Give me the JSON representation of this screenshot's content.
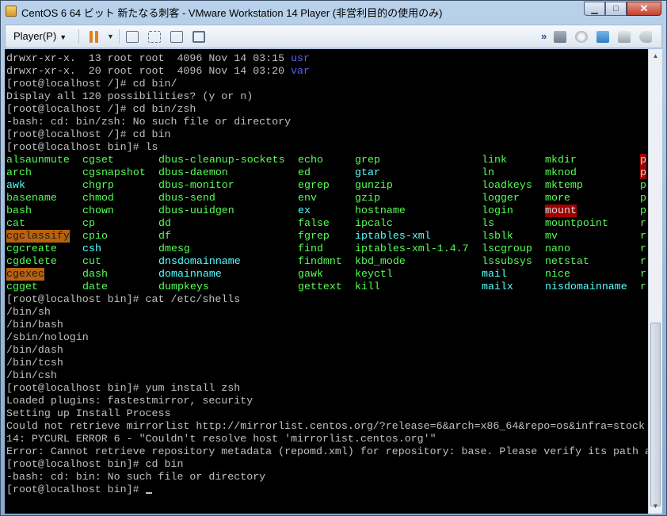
{
  "window": {
    "title": "CentOS 6 64 ビット 新たなる刺客 - VMware Workstation 14 Player (非営利目的の使用のみ)"
  },
  "toolbar": {
    "player_label": "Player(P)"
  },
  "colors": {
    "terminal_bg": "#000000",
    "text": "#c0c0c0",
    "exec_green": "#55ff55",
    "dir_blue": "#5c5cff",
    "link_cyan": "#55ffff",
    "setgid_orange": "#b8620f",
    "setuid_red": "#a00000"
  },
  "terminal": {
    "pre": [
      {
        "prefix": "drwxr-xr-x.  13 root root  4096 Nov 14 03:15 ",
        "dir": "usr"
      },
      {
        "prefix": "drwxr-xr-x.  20 root root  4096 Nov 14 03:20 ",
        "dir": "var"
      },
      {
        "text": "[root@localhost /]# cd bin/"
      },
      {
        "text": "Display all 120 possibilities? (y or n)"
      },
      {
        "text": "[root@localhost /]# cd bin/zsh"
      },
      {
        "text": "-bash: cd: bin/zsh: No such file or directory"
      },
      {
        "text": "[root@localhost /]# cd bin"
      },
      {
        "text": "[root@localhost bin]# ls"
      }
    ],
    "ls_rows": [
      [
        {
          "t": "alsaunmute",
          "c": "green"
        },
        {
          "t": "cgset",
          "c": "green"
        },
        {
          "t": "dbus-cleanup-sockets",
          "c": "green"
        },
        {
          "t": "echo",
          "c": "green"
        },
        {
          "t": "grep",
          "c": "green"
        },
        {
          "t": "link",
          "c": "green"
        },
        {
          "t": "mkdir",
          "c": "green"
        },
        {
          "t": "p",
          "c": "hl-red"
        }
      ],
      [
        {
          "t": "arch",
          "c": "green"
        },
        {
          "t": "cgsnapshot",
          "c": "green"
        },
        {
          "t": "dbus-daemon",
          "c": "green"
        },
        {
          "t": "ed",
          "c": "green"
        },
        {
          "t": "gtar",
          "c": "cyan"
        },
        {
          "t": "ln",
          "c": "green"
        },
        {
          "t": "mknod",
          "c": "green"
        },
        {
          "t": "p",
          "c": "hl-red"
        }
      ],
      [
        {
          "t": "awk",
          "c": "cyan"
        },
        {
          "t": "chgrp",
          "c": "green"
        },
        {
          "t": "dbus-monitor",
          "c": "green"
        },
        {
          "t": "egrep",
          "c": "green"
        },
        {
          "t": "gunzip",
          "c": "green"
        },
        {
          "t": "loadkeys",
          "c": "green"
        },
        {
          "t": "mktemp",
          "c": "green"
        },
        {
          "t": "p",
          "c": "green"
        }
      ],
      [
        {
          "t": "basename",
          "c": "green"
        },
        {
          "t": "chmod",
          "c": "green"
        },
        {
          "t": "dbus-send",
          "c": "green"
        },
        {
          "t": "env",
          "c": "green"
        },
        {
          "t": "gzip",
          "c": "green"
        },
        {
          "t": "logger",
          "c": "green"
        },
        {
          "t": "more",
          "c": "green"
        },
        {
          "t": "p",
          "c": "green"
        }
      ],
      [
        {
          "t": "bash",
          "c": "green"
        },
        {
          "t": "chown",
          "c": "green"
        },
        {
          "t": "dbus-uuidgen",
          "c": "green"
        },
        {
          "t": "ex",
          "c": "cyan"
        },
        {
          "t": "hostname",
          "c": "green"
        },
        {
          "t": "login",
          "c": "green"
        },
        {
          "t": "mount",
          "c": "hl-red"
        },
        {
          "t": "p",
          "c": "green"
        }
      ],
      [
        {
          "t": "cat",
          "c": "green"
        },
        {
          "t": "cp",
          "c": "green"
        },
        {
          "t": "dd",
          "c": "green"
        },
        {
          "t": "false",
          "c": "green"
        },
        {
          "t": "ipcalc",
          "c": "green"
        },
        {
          "t": "ls",
          "c": "green"
        },
        {
          "t": "mountpoint",
          "c": "green"
        },
        {
          "t": "r",
          "c": "green"
        }
      ],
      [
        {
          "t": "cgclassify",
          "c": "hl-orange"
        },
        {
          "t": "cpio",
          "c": "green"
        },
        {
          "t": "df",
          "c": "green"
        },
        {
          "t": "fgrep",
          "c": "green"
        },
        {
          "t": "iptables-xml",
          "c": "cyan"
        },
        {
          "t": "lsblk",
          "c": "green"
        },
        {
          "t": "mv",
          "c": "green"
        },
        {
          "t": "r",
          "c": "green"
        }
      ],
      [
        {
          "t": "cgcreate",
          "c": "green"
        },
        {
          "t": "csh",
          "c": "cyan"
        },
        {
          "t": "dmesg",
          "c": "green"
        },
        {
          "t": "find",
          "c": "green"
        },
        {
          "t": "iptables-xml-1.4.7",
          "c": "green"
        },
        {
          "t": "lscgroup",
          "c": "green"
        },
        {
          "t": "nano",
          "c": "green"
        },
        {
          "t": "r",
          "c": "green"
        }
      ],
      [
        {
          "t": "cgdelete",
          "c": "green"
        },
        {
          "t": "cut",
          "c": "green"
        },
        {
          "t": "dnsdomainname",
          "c": "cyan"
        },
        {
          "t": "findmnt",
          "c": "green"
        },
        {
          "t": "kbd_mode",
          "c": "green"
        },
        {
          "t": "lssubsys",
          "c": "green"
        },
        {
          "t": "netstat",
          "c": "green"
        },
        {
          "t": "r",
          "c": "green"
        }
      ],
      [
        {
          "t": "cgexec",
          "c": "hl-orange"
        },
        {
          "t": "dash",
          "c": "green"
        },
        {
          "t": "domainname",
          "c": "cyan"
        },
        {
          "t": "gawk",
          "c": "green"
        },
        {
          "t": "keyctl",
          "c": "green"
        },
        {
          "t": "mail",
          "c": "cyan"
        },
        {
          "t": "nice",
          "c": "green"
        },
        {
          "t": "r",
          "c": "green"
        }
      ],
      [
        {
          "t": "cgget",
          "c": "green"
        },
        {
          "t": "date",
          "c": "green"
        },
        {
          "t": "dumpkeys",
          "c": "green"
        },
        {
          "t": "gettext",
          "c": "green"
        },
        {
          "t": "kill",
          "c": "green"
        },
        {
          "t": "mailx",
          "c": "cyan"
        },
        {
          "t": "nisdomainname",
          "c": "cyan"
        },
        {
          "t": "r",
          "c": "green"
        }
      ]
    ],
    "post": [
      "[root@localhost bin]# cat /etc/shells",
      "/bin/sh",
      "/bin/bash",
      "/sbin/nologin",
      "/bin/dash",
      "/bin/tcsh",
      "/bin/csh",
      "[root@localhost bin]# yum install zsh",
      "Loaded plugins: fastestmirror, security",
      "Setting up Install Process",
      "Could not retrieve mirrorlist http://mirrorlist.centos.org/?release=6&arch=x86_64&repo=os&infra=stock",
      "14: PYCURL ERROR 6 - \"Couldn't resolve host 'mirrorlist.centos.org'\"",
      "Error: Cannot retrieve repository metadata (repomd.xml) for repository: base. Please verify its path a",
      "[root@localhost bin]# cd bin",
      "-bash: cd: bin: No such file or directory"
    ],
    "prompt": "[root@localhost bin]# "
  }
}
